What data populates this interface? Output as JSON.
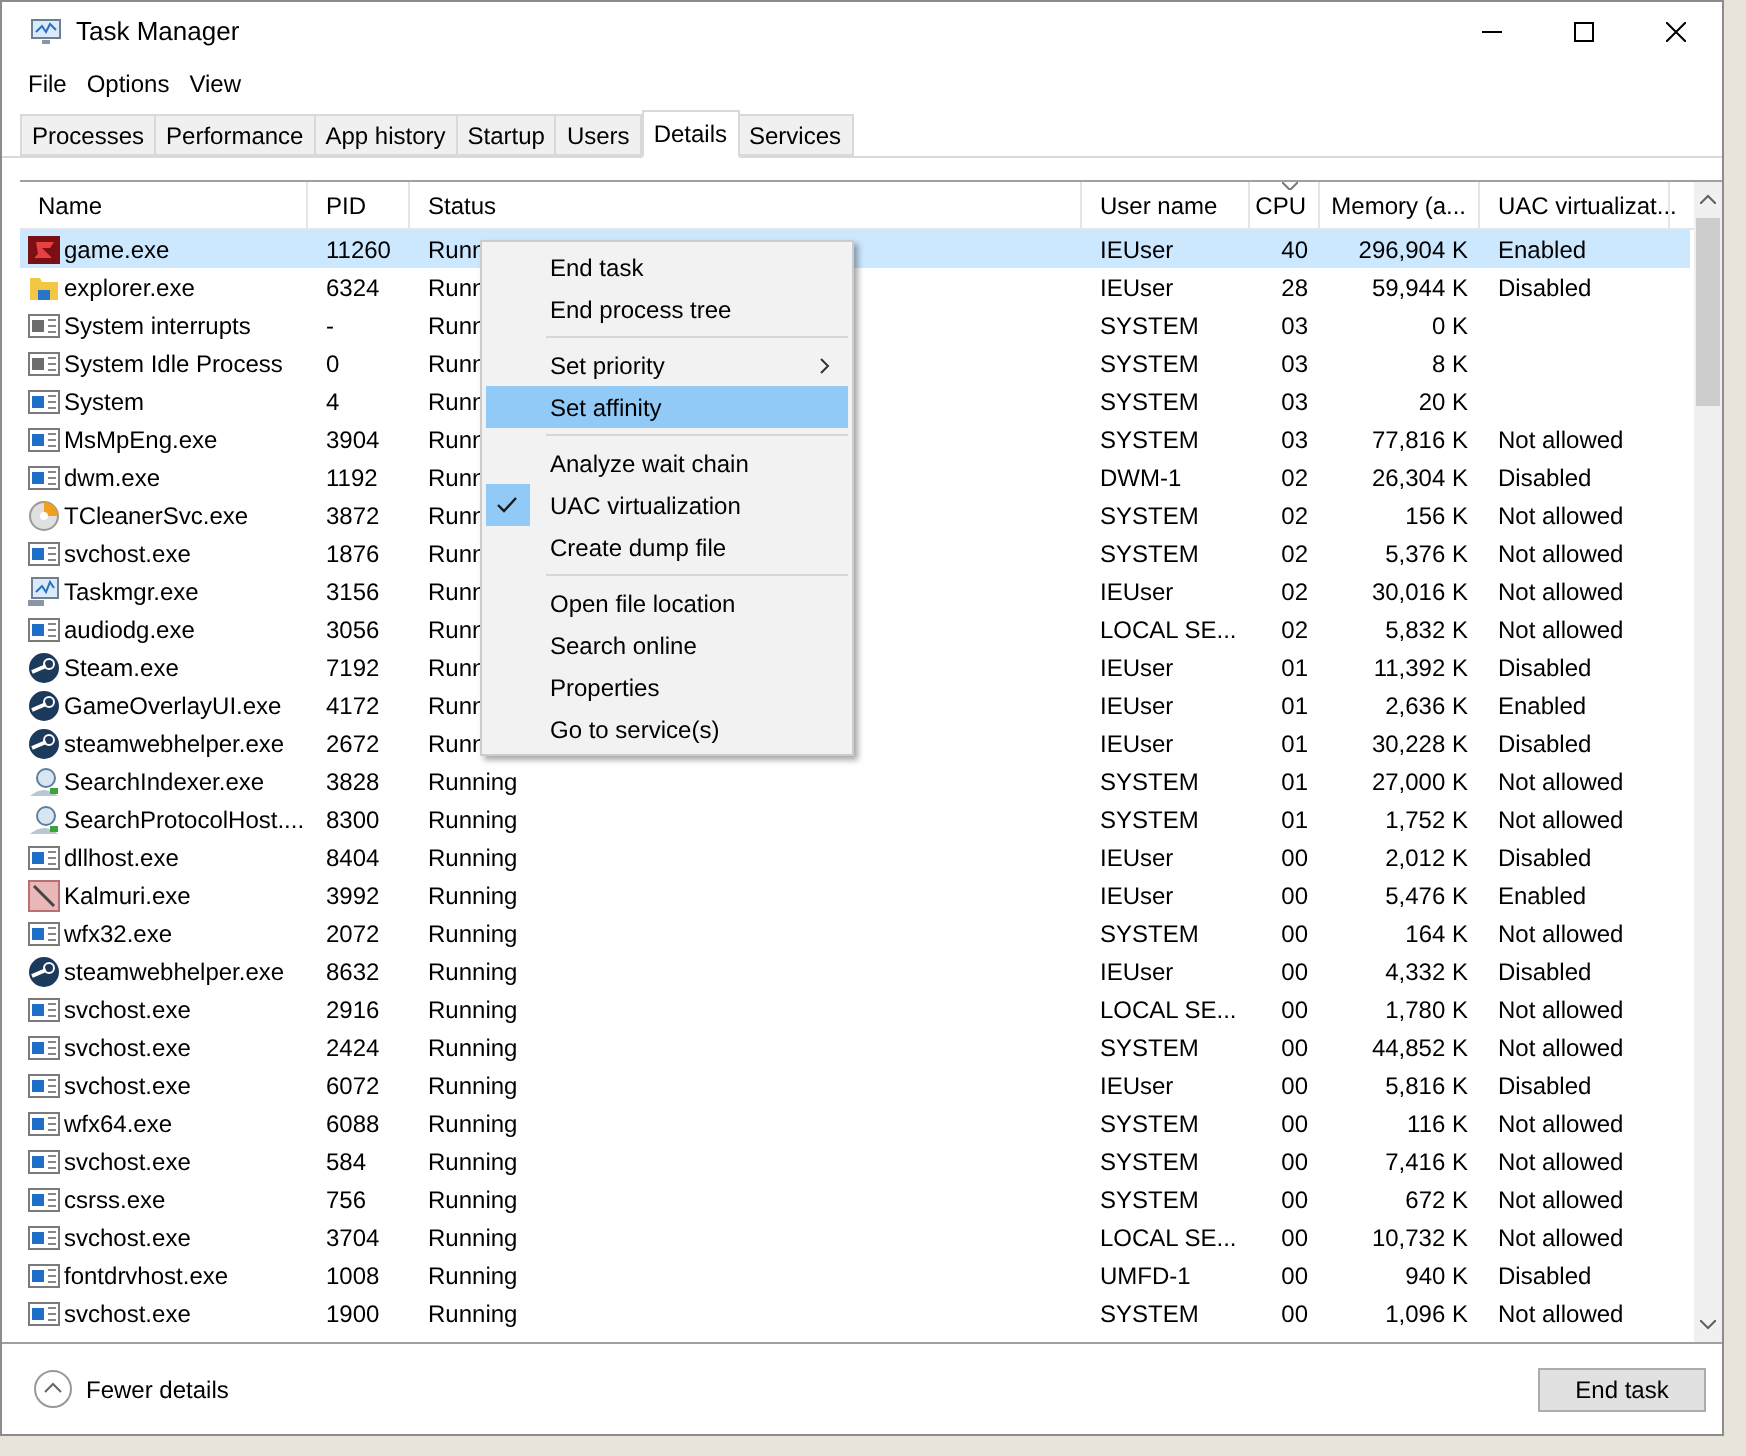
{
  "window": {
    "title": "Task Manager"
  },
  "menu_bar": [
    "File",
    "Options",
    "View"
  ],
  "tabs": [
    {
      "label": "Processes",
      "selected": false
    },
    {
      "label": "Performance",
      "selected": false
    },
    {
      "label": "App history",
      "selected": false
    },
    {
      "label": "Startup",
      "selected": false
    },
    {
      "label": "Users",
      "selected": false
    },
    {
      "label": "Details",
      "selected": true
    },
    {
      "label": "Services",
      "selected": false
    }
  ],
  "table": {
    "columns": [
      {
        "label": "Name",
        "sorted": false
      },
      {
        "label": "PID",
        "sorted": false
      },
      {
        "label": "Status",
        "sorted": false
      },
      {
        "label": "User name",
        "sorted": false
      },
      {
        "label": "CPU",
        "sorted": true
      },
      {
        "label": "Memory (a...",
        "sorted": false
      },
      {
        "label": "UAC virtualizat...",
        "sorted": false
      }
    ],
    "rows": [
      {
        "kind": "game",
        "name": "game.exe",
        "pid": "11260",
        "status": "Runn",
        "user": "IEUser",
        "cpu": "40",
        "memory": "296,904 K",
        "uac": "Enabled",
        "selected": true
      },
      {
        "kind": "folder",
        "name": "explorer.exe",
        "pid": "6324",
        "status": "Runn",
        "user": "IEUser",
        "cpu": "28",
        "memory": "59,944 K",
        "uac": "Disabled",
        "selected": false
      },
      {
        "kind": "sysmon",
        "name": "System interrupts",
        "pid": "-",
        "status": "Runn",
        "user": "SYSTEM",
        "cpu": "03",
        "memory": "0 K",
        "selected": false
      },
      {
        "kind": "sysmon",
        "name": "System Idle Process",
        "pid": "0",
        "status": "Runn",
        "user": "SYSTEM",
        "cpu": "03",
        "memory": "8 K",
        "selected": false
      },
      {
        "kind": "window",
        "name": "System",
        "pid": "4",
        "status": "Runn",
        "user": "SYSTEM",
        "cpu": "03",
        "memory": "20 K",
        "selected": false
      },
      {
        "kind": "window",
        "name": "MsMpEng.exe",
        "pid": "3904",
        "status": "Runn",
        "user": "SYSTEM",
        "cpu": "03",
        "memory": "77,816 K",
        "uac": "Not allowed",
        "selected": false
      },
      {
        "kind": "window",
        "name": "dwm.exe",
        "pid": "1192",
        "status": "Runn",
        "user": "DWM-1",
        "cpu": "02",
        "memory": "26,304 K",
        "uac": "Disabled",
        "selected": false
      },
      {
        "kind": "disc",
        "name": "TCleanerSvc.exe",
        "pid": "3872",
        "status": "Runn",
        "user": "SYSTEM",
        "cpu": "02",
        "memory": "156 K",
        "uac": "Not allowed",
        "selected": false
      },
      {
        "kind": "window",
        "name": "svchost.exe",
        "pid": "1876",
        "status": "Runn",
        "user": "SYSTEM",
        "cpu": "02",
        "memory": "5,376 K",
        "uac": "Not allowed",
        "selected": false
      },
      {
        "kind": "monitor",
        "name": "Taskmgr.exe",
        "pid": "3156",
        "status": "Runn",
        "user": "IEUser",
        "cpu": "02",
        "memory": "30,016 K",
        "uac": "Not allowed",
        "selected": false
      },
      {
        "kind": "window",
        "name": "audiodg.exe",
        "pid": "3056",
        "status": "Runn",
        "user": "LOCAL SE...",
        "cpu": "02",
        "memory": "5,832 K",
        "uac": "Not allowed",
        "selected": false
      },
      {
        "kind": "steam",
        "name": "Steam.exe",
        "pid": "7192",
        "status": "Runn",
        "user": "IEUser",
        "cpu": "01",
        "memory": "11,392 K",
        "uac": "Disabled",
        "selected": false
      },
      {
        "kind": "steam",
        "name": "GameOverlayUI.exe",
        "pid": "4172",
        "status": "Runn",
        "user": "IEUser",
        "cpu": "01",
        "memory": "2,636 K",
        "uac": "Enabled",
        "selected": false
      },
      {
        "kind": "steam",
        "name": "steamwebhelper.exe",
        "pid": "2672",
        "status": "Runn",
        "user": "IEUser",
        "cpu": "01",
        "memory": "30,228 K",
        "uac": "Disabled",
        "selected": false
      },
      {
        "kind": "search",
        "name": "SearchIndexer.exe",
        "pid": "3828",
        "status": "Running",
        "user": "SYSTEM",
        "cpu": "01",
        "memory": "27,000 K",
        "uac": "Not allowed",
        "selected": false
      },
      {
        "kind": "search",
        "name": "SearchProtocolHost....",
        "pid": "8300",
        "status": "Running",
        "user": "SYSTEM",
        "cpu": "01",
        "memory": "1,752 K",
        "uac": "Not allowed",
        "selected": false
      },
      {
        "kind": "window",
        "name": "dllhost.exe",
        "pid": "8404",
        "status": "Running",
        "user": "IEUser",
        "cpu": "00",
        "memory": "2,012 K",
        "uac": "Disabled",
        "selected": false
      },
      {
        "kind": "brush",
        "name": "Kalmuri.exe",
        "pid": "3992",
        "status": "Running",
        "user": "IEUser",
        "cpu": "00",
        "memory": "5,476 K",
        "uac": "Enabled",
        "selected": false
      },
      {
        "kind": "window",
        "name": "wfx32.exe",
        "pid": "2072",
        "status": "Running",
        "user": "SYSTEM",
        "cpu": "00",
        "memory": "164 K",
        "uac": "Not allowed",
        "selected": false
      },
      {
        "kind": "steam",
        "name": "steamwebhelper.exe",
        "pid": "8632",
        "status": "Running",
        "user": "IEUser",
        "cpu": "00",
        "memory": "4,332 K",
        "uac": "Disabled",
        "selected": false
      },
      {
        "kind": "window",
        "name": "svchost.exe",
        "pid": "2916",
        "status": "Running",
        "user": "LOCAL SE...",
        "cpu": "00",
        "memory": "1,780 K",
        "uac": "Not allowed",
        "selected": false
      },
      {
        "kind": "window",
        "name": "svchost.exe",
        "pid": "2424",
        "status": "Running",
        "user": "SYSTEM",
        "cpu": "00",
        "memory": "44,852 K",
        "uac": "Not allowed",
        "selected": false
      },
      {
        "kind": "window",
        "name": "svchost.exe",
        "pid": "6072",
        "status": "Running",
        "user": "IEUser",
        "cpu": "00",
        "memory": "5,816 K",
        "uac": "Disabled",
        "selected": false
      },
      {
        "kind": "window",
        "name": "wfx64.exe",
        "pid": "6088",
        "status": "Running",
        "user": "SYSTEM",
        "cpu": "00",
        "memory": "116 K",
        "uac": "Not allowed",
        "selected": false
      },
      {
        "kind": "window",
        "name": "svchost.exe",
        "pid": "584",
        "status": "Running",
        "user": "SYSTEM",
        "cpu": "00",
        "memory": "7,416 K",
        "uac": "Not allowed",
        "selected": false
      },
      {
        "kind": "window",
        "name": "csrss.exe",
        "pid": "756",
        "status": "Running",
        "user": "SYSTEM",
        "cpu": "00",
        "memory": "672 K",
        "uac": "Not allowed",
        "selected": false
      },
      {
        "kind": "window",
        "name": "svchost.exe",
        "pid": "3704",
        "status": "Running",
        "user": "LOCAL SE...",
        "cpu": "00",
        "memory": "10,732 K",
        "uac": "Not allowed",
        "selected": false
      },
      {
        "kind": "window",
        "name": "fontdrvhost.exe",
        "pid": "1008",
        "status": "Running",
        "user": "UMFD-1",
        "cpu": "00",
        "memory": "940 K",
        "uac": "Disabled",
        "selected": false
      },
      {
        "kind": "window",
        "name": "svchost.exe",
        "pid": "1900",
        "status": "Running",
        "user": "SYSTEM",
        "cpu": "00",
        "memory": "1,096 K",
        "uac": "Not allowed",
        "selected": false
      }
    ]
  },
  "context_menu": [
    {
      "kind": "item",
      "label": "End task",
      "selected": false,
      "checked": false,
      "submenu": false
    },
    {
      "kind": "item",
      "label": "End process tree",
      "selected": false,
      "checked": false,
      "submenu": false
    },
    {
      "kind": "separator"
    },
    {
      "kind": "item",
      "label": "Set priority",
      "selected": false,
      "checked": false,
      "submenu": true
    },
    {
      "kind": "item",
      "label": "Set affinity",
      "selected": true,
      "checked": false,
      "submenu": false
    },
    {
      "kind": "separator"
    },
    {
      "kind": "item",
      "label": "Analyze wait chain",
      "selected": false,
      "checked": false,
      "submenu": false
    },
    {
      "kind": "item",
      "label": "UAC virtualization",
      "selected": false,
      "checked": true,
      "submenu": false
    },
    {
      "kind": "item",
      "label": "Create dump file",
      "selected": false,
      "checked": false,
      "submenu": false
    },
    {
      "kind": "separator"
    },
    {
      "kind": "item",
      "label": "Open file location",
      "selected": false,
      "checked": false,
      "submenu": false
    },
    {
      "kind": "item",
      "label": "Search online",
      "selected": false,
      "checked": false,
      "submenu": false
    },
    {
      "kind": "item",
      "label": "Properties",
      "selected": false,
      "checked": false,
      "submenu": false
    },
    {
      "kind": "item",
      "label": "Go to service(s)",
      "selected": false,
      "checked": false,
      "submenu": false
    }
  ],
  "footer": {
    "toggle": "Fewer details",
    "button": "End task"
  }
}
